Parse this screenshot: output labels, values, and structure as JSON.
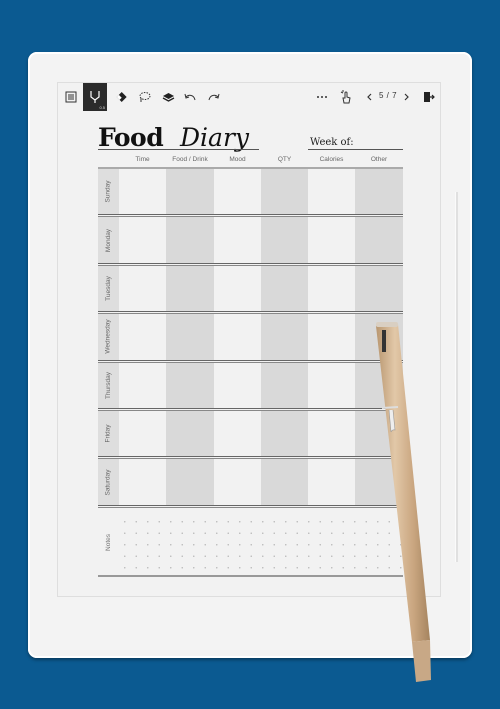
{
  "device": {
    "toolbar": {
      "menu_icon": "list-menu-icon",
      "pen_tool_label": "0.5",
      "eraser_icon": "eraser-icon",
      "lasso_icon": "lasso-select-icon",
      "layers_icon": "layers-icon",
      "undo_icon": "undo-icon",
      "redo_icon": "redo-icon",
      "more_icon": "more-dots-icon",
      "touch_icon": "touch-gesture-icon",
      "prev_icon": "chevron-left-icon",
      "page_counter": "5 / 7",
      "next_icon": "chevron-right-icon",
      "exit_icon": "exit-door-icon"
    }
  },
  "template": {
    "title_bold": "Food",
    "title_italic": "Diary",
    "week_label": "Week of:",
    "columns": [
      "Time",
      "Food / Drink",
      "Mood",
      "QTY",
      "Calories",
      "Other"
    ],
    "days": [
      "Sunday",
      "Monday",
      "Tuesday",
      "Wednesday",
      "Thursday",
      "Friday",
      "Saturday"
    ],
    "notes_label": "Notes"
  },
  "colors": {
    "background": "#0b5a91",
    "pen_gold": "#c8a886",
    "cell_gray": "#d9d9d9"
  }
}
